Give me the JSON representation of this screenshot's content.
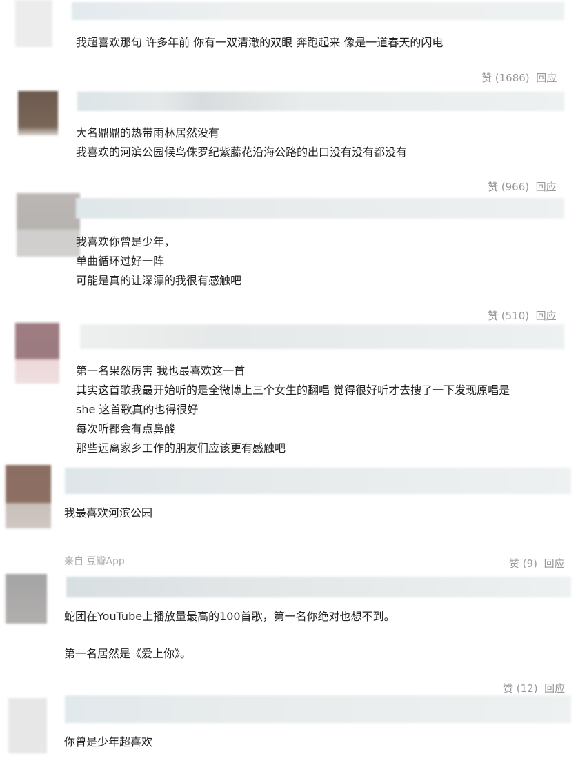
{
  "comments": [
    {
      "lines": [
        "我超喜欢那句 许多年前 你有一双清澈的双眼 奔跑起来 像是一道春天的闪电"
      ],
      "likes": "赞 (1686)",
      "reply": "回应"
    },
    {
      "lines": [
        "大名鼎鼎的热带雨林居然没有",
        "我喜欢的河滨公园候鸟侏罗纪紫藤花沿海公路的出口没有没有都没有"
      ],
      "likes": "赞 (966)",
      "reply": "回应"
    },
    {
      "lines": [
        "我喜欢你曾是少年，",
        "单曲循环过好一阵",
        "可能是真的让深漂的我很有感触吧"
      ],
      "likes": "赞 (510)",
      "reply": "回应"
    },
    {
      "lines": [
        "第一名果然厉害 我也最喜欢这一首",
        "其实这首歌我最开始听的是全微博上三个女生的翻唱 觉得很好听才去搜了一下发现原唱是",
        "she 这首歌真的也得很好",
        "每次听都会有点鼻酸",
        "那些远离家乡工作的朋友们应该更有感触吧"
      ]
    },
    {
      "lines": [
        "我最喜欢河滨公园"
      ],
      "source": "来自 豆瓣App",
      "likes": "赞 (9)",
      "reply": "回应"
    },
    {
      "lines": [
        "蛇团在YouTube上播放量最高的100首歌，第一名你绝对也想不到。",
        "",
        "第一名居然是《爱上你》。"
      ],
      "likes": "赞 (12)",
      "reply": "回应"
    },
    {
      "lines": [
        "你曾是少年超喜欢"
      ]
    }
  ],
  "colors": {
    "text": "#222222",
    "meta": "#999999",
    "blurred_bar": "#eef1f1"
  }
}
